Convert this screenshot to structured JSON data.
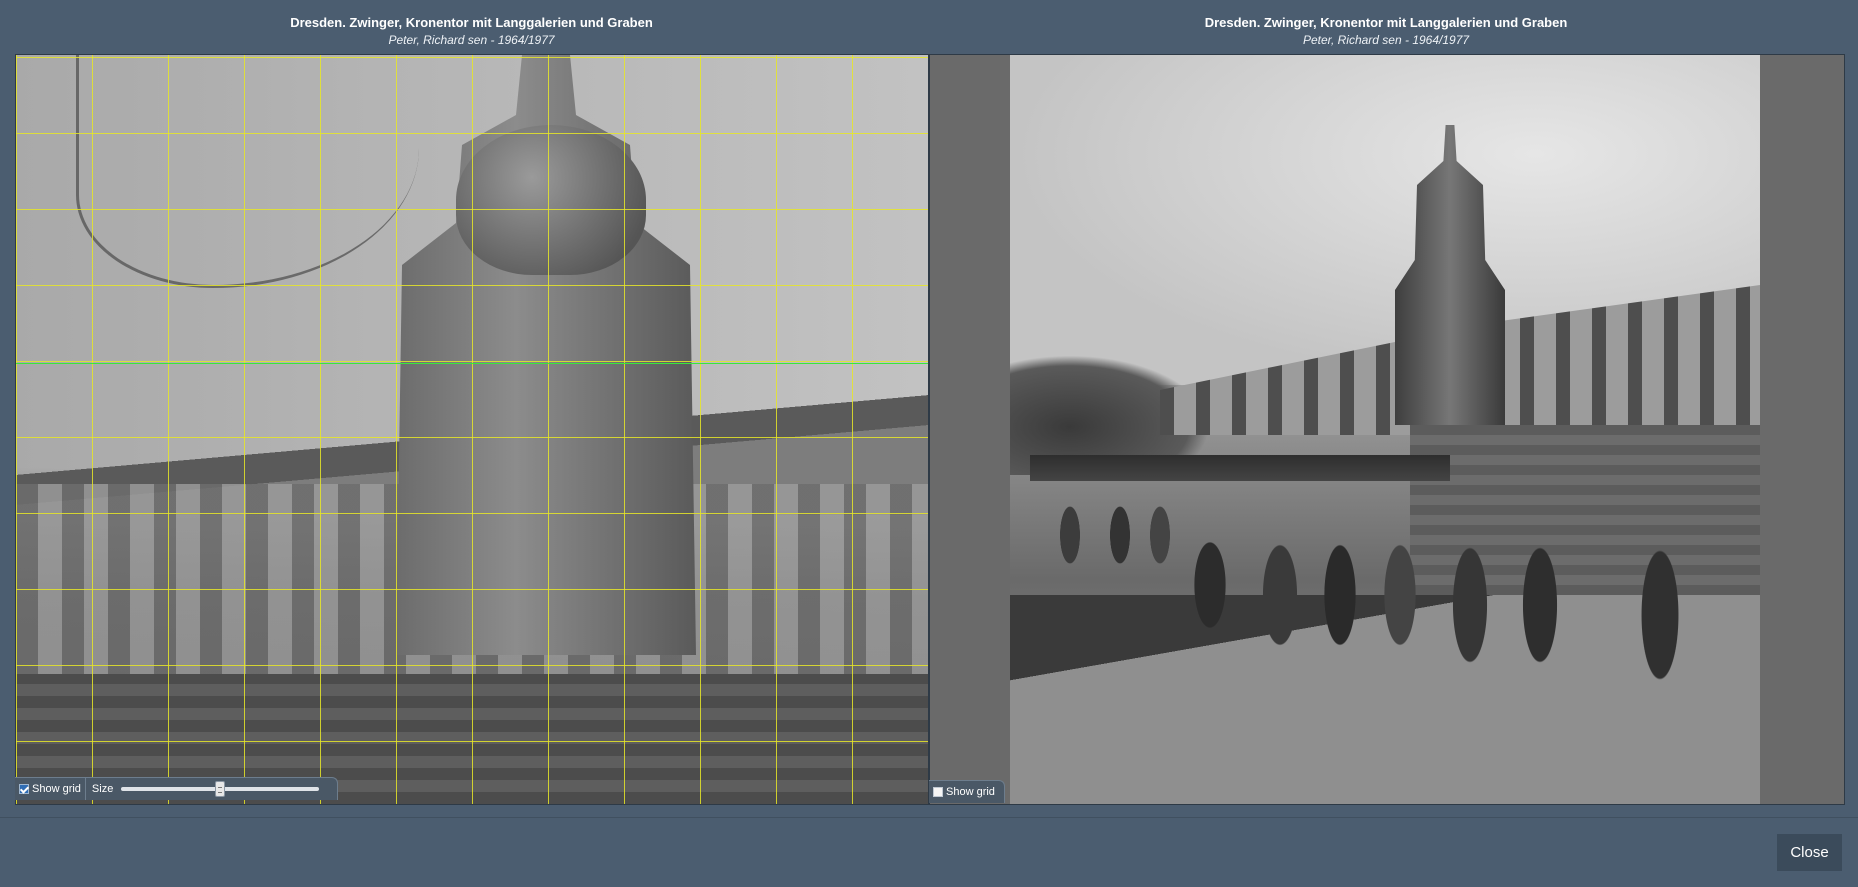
{
  "left_pane": {
    "title": "Dresden. Zwinger, Kronentor mit Langgalerien und Graben",
    "subtitle": "Peter, Richard sen - 1964/1977",
    "show_grid_label": "Show grid",
    "show_grid_checked": true,
    "size_label": "Size",
    "size_slider_value": 0.5
  },
  "right_pane": {
    "title": "Dresden. Zwinger, Kronentor mit Langgalerien und Graben",
    "subtitle": "Peter, Richard sen - 1964/1977",
    "show_grid_label": "Show grid",
    "show_grid_checked": false
  },
  "footer": {
    "close_label": "Close"
  },
  "colors": {
    "background": "#4b5d70",
    "grid_line": "#e6e628",
    "horizon_line": "#38e83a",
    "button": "#3b4b5b"
  }
}
